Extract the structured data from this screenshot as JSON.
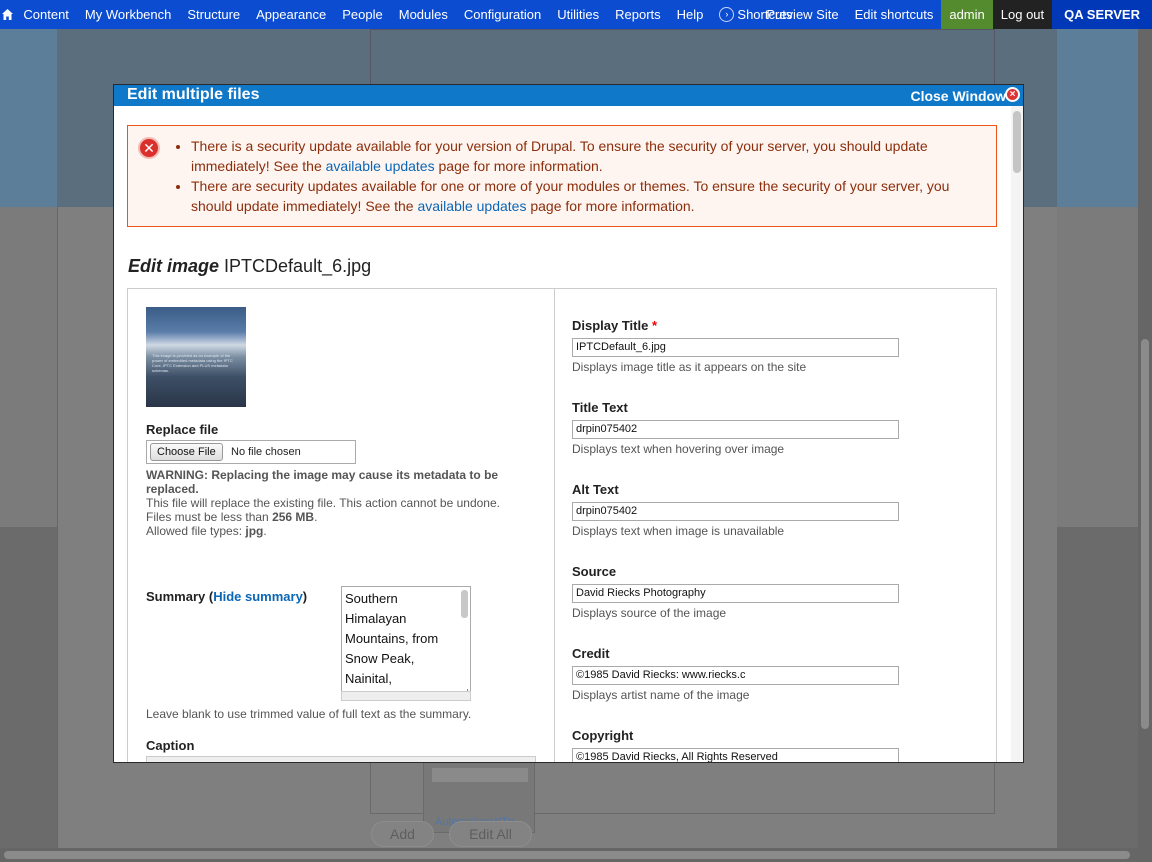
{
  "toolbar": {
    "items": [
      "Content",
      "My Workbench",
      "Structure",
      "Appearance",
      "People",
      "Modules",
      "Configuration",
      "Utilities",
      "Reports",
      "Help"
    ],
    "shortcuts": "Shortcuts",
    "preview_site": "Preview Site",
    "edit_shortcuts": "Edit shortcuts",
    "admin": "admin",
    "logout": "Log out",
    "server": "QA SERVER"
  },
  "background": {
    "thumb_caption": "AutomationWTh...",
    "add_button": "Add",
    "edit_all_button": "Edit All"
  },
  "modal": {
    "title": "Edit multiple files",
    "close_label": "Close Window",
    "errors": {
      "msg1_before": "There is a security update available for your version of Drupal. To ensure the security of your server, you should update immediately! See the ",
      "msg1_link": "available updates",
      "msg1_after": " page for more information.",
      "msg2_before": "There are security updates available for one or more of your modules or themes. To ensure the security of your server, you should update immediately! See the ",
      "msg2_link": "available updates",
      "msg2_after": " page for more information."
    },
    "heading_em": "Edit image",
    "heading_file": " IPTCDefault_6.jpg",
    "thumb_text": "This image is provided as an example of the power of embedded metadata using the IPTC Core, IPTC Extension and PLUS metadata schemas.",
    "replace_label": "Replace file",
    "choose_file": "Choose File",
    "no_file": "No file chosen",
    "warning_bold": "WARNING: Replacing the image may cause its metadata to be replaced.",
    "warning_line2": "This file will replace the existing file. This action cannot be undone.",
    "size_before": "Files must be less than ",
    "size_value": "256 MB",
    "size_after": ".",
    "types_before": "Allowed file types: ",
    "types_value": "jpg",
    "types_after": ".",
    "summary_label": "Summary (",
    "summary_link": "Hide summary",
    "summary_close": ")",
    "summary_lines": [
      "Southern",
      "Himalayan",
      "Mountains, from",
      "Snow Peak,",
      "Nainital,"
    ],
    "summary_help": "Leave blank to use trimmed value of full text as the summary.",
    "caption_label": "Caption",
    "fields": [
      {
        "label": "Display Title",
        "required": "*",
        "value": "IPTCDefault_6.jpg",
        "help": "Displays image title as it appears on the site"
      },
      {
        "label": "Title Text",
        "required": "",
        "value": "drpin075402",
        "help": "Displays text when hovering over image"
      },
      {
        "label": "Alt Text",
        "required": "",
        "value": "drpin075402",
        "help": "Displays text when image is unavailable"
      },
      {
        "label": "Source",
        "required": "",
        "value": "David Riecks Photography",
        "help": "Displays source of the image"
      },
      {
        "label": "Credit",
        "required": "",
        "value": "©1985 David Riecks: www.riecks.c",
        "help": "Displays artist name of the image"
      },
      {
        "label": "Copyright",
        "required": "",
        "value": "©1985 David Riecks, All Rights Reserved",
        "help": ""
      }
    ]
  }
}
